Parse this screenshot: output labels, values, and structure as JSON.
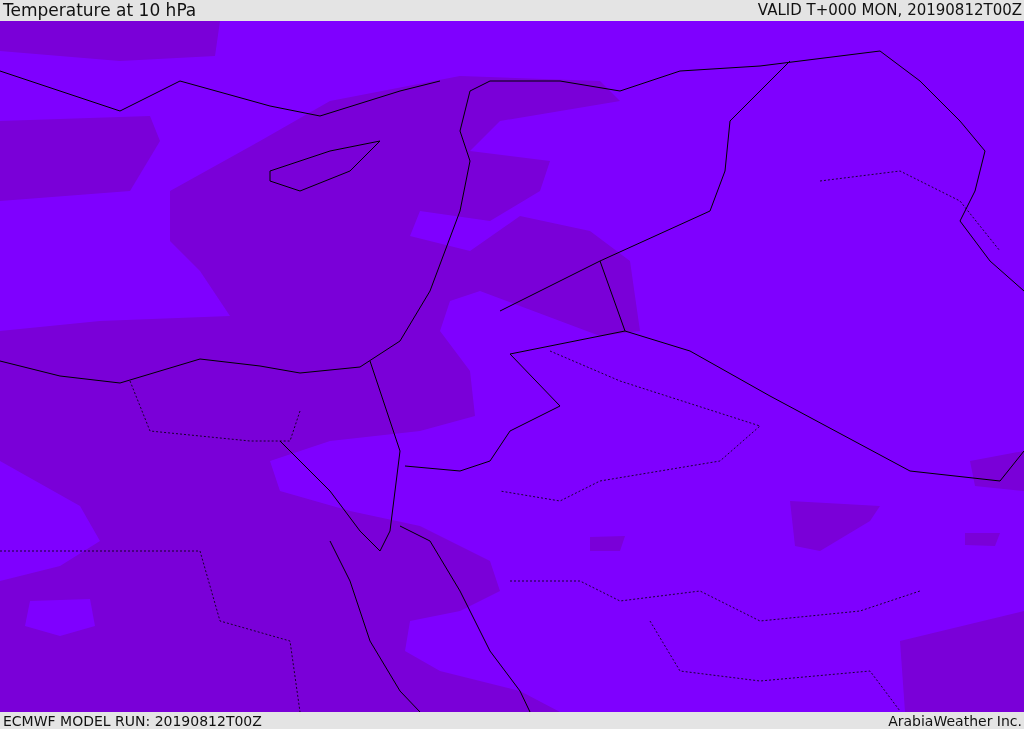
{
  "header": {
    "title": "Temperature at 10 hPa",
    "valid": "VALID T+000 MON, 20190812T00Z"
  },
  "footer": {
    "model_run": "ECMWF MODEL RUN: 20190812T00Z",
    "credit": "ArabiaWeather Inc."
  }
}
